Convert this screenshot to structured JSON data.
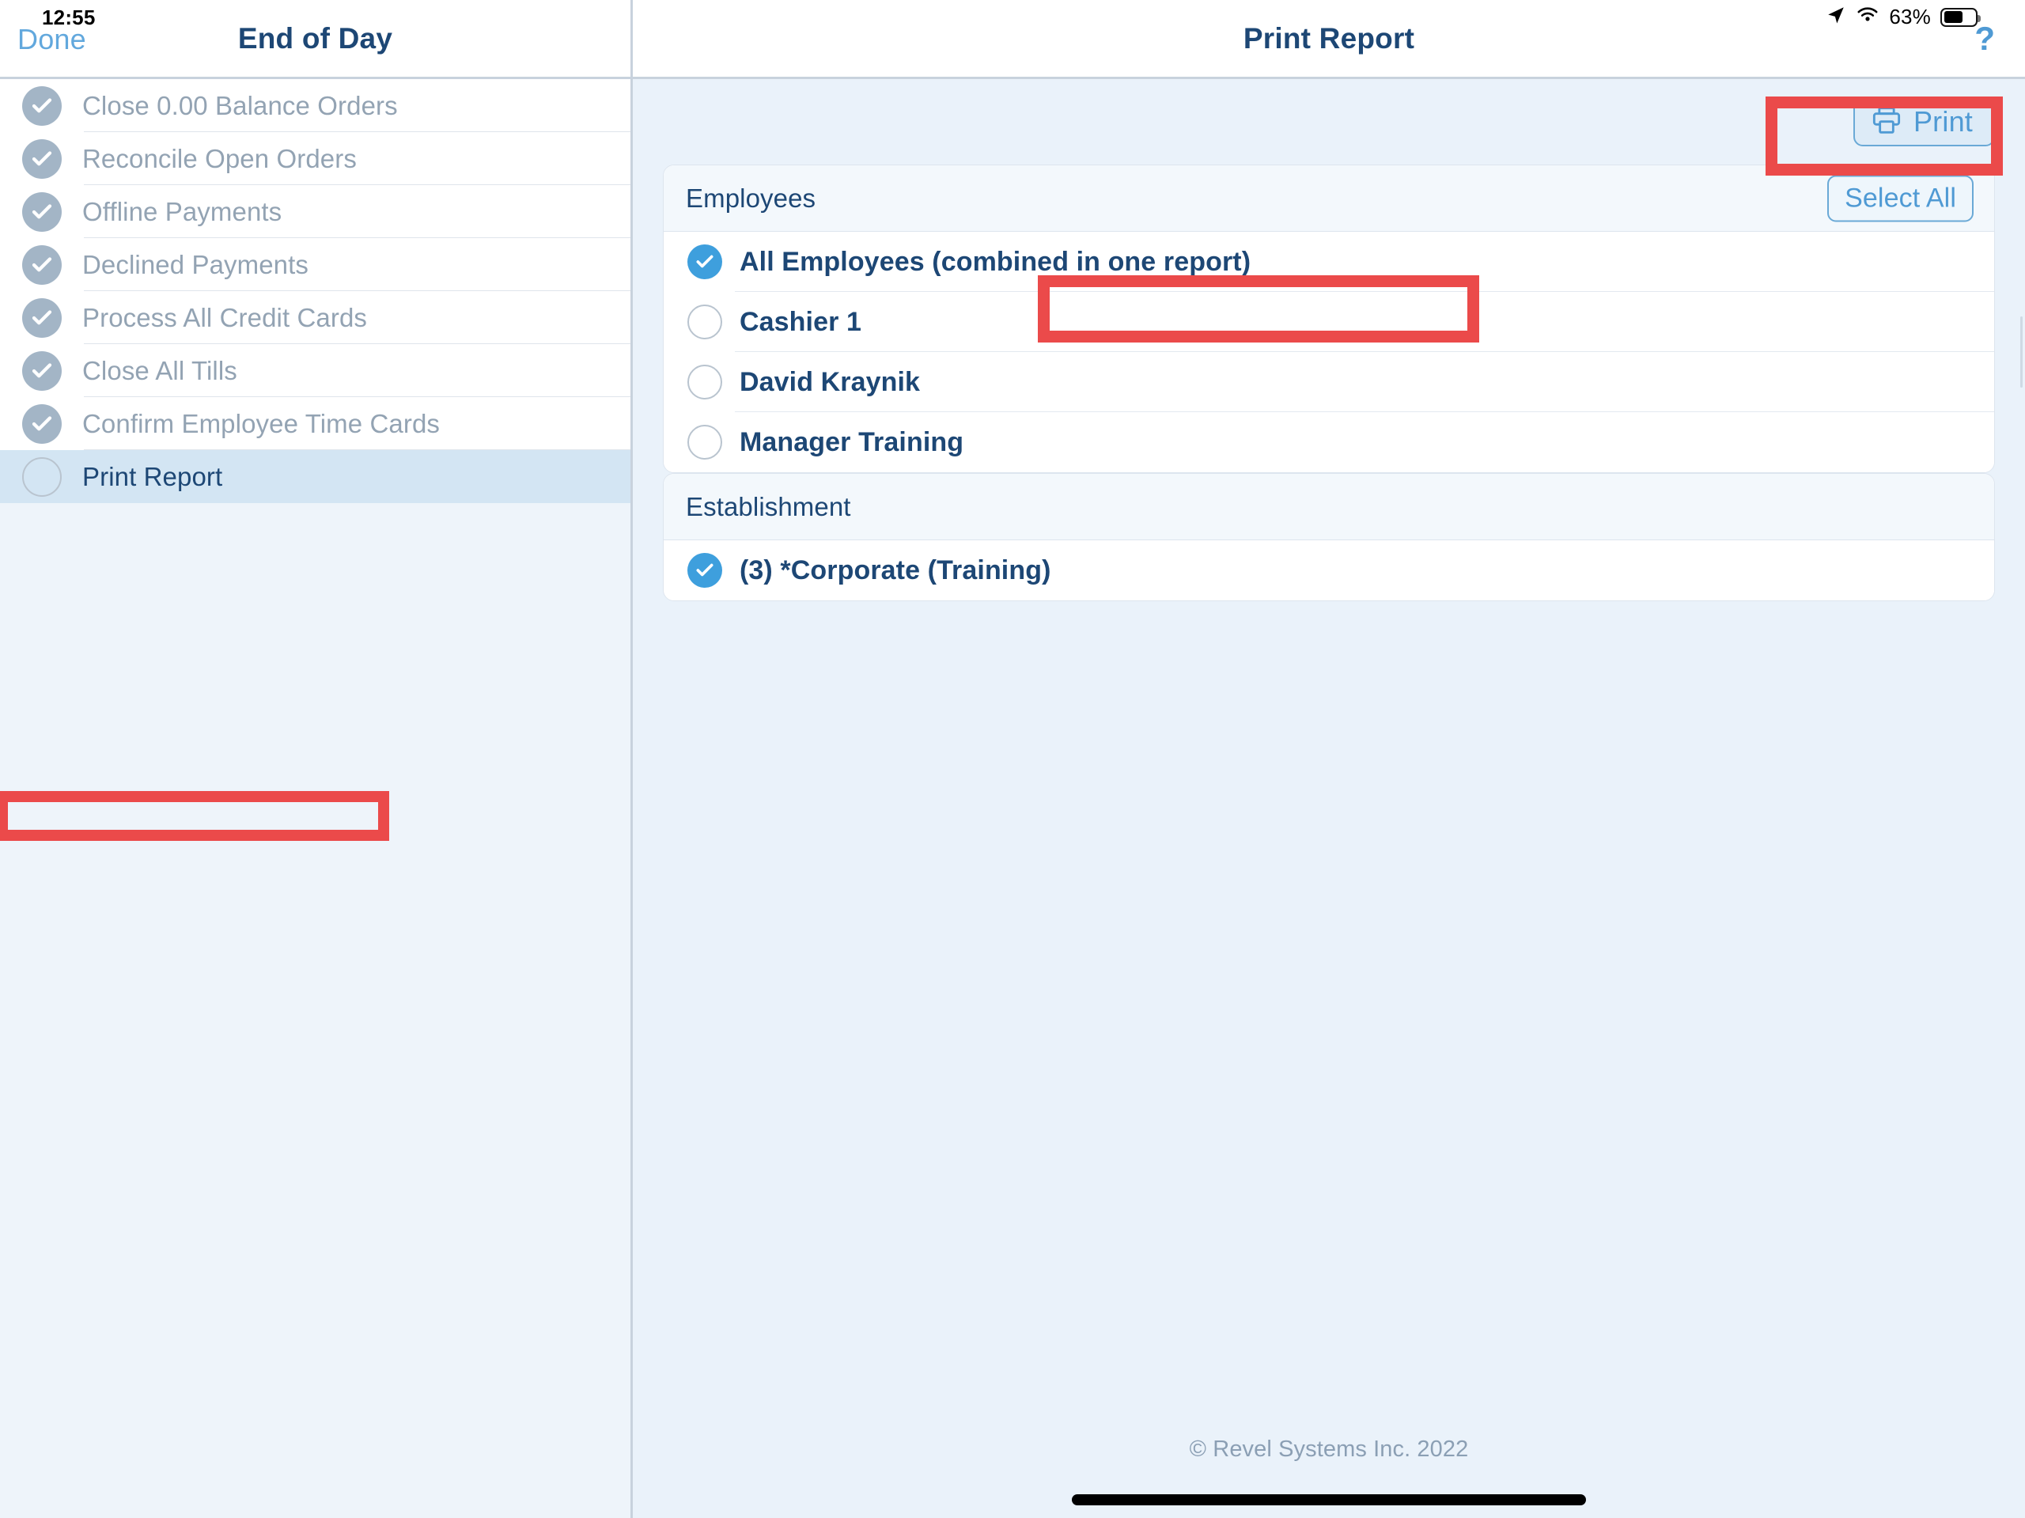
{
  "status_bar": {
    "time": "12:55",
    "battery_percent": "63%",
    "battery_level": 63,
    "location_icon": "location-arrow-icon",
    "wifi_icon": "wifi-icon"
  },
  "sidebar": {
    "done_label": "Done",
    "title": "End of Day",
    "items": [
      {
        "label": "Close 0.00 Balance Orders",
        "state": "checked"
      },
      {
        "label": "Reconcile Open Orders",
        "state": "checked"
      },
      {
        "label": "Offline Payments",
        "state": "checked"
      },
      {
        "label": "Declined Payments",
        "state": "checked"
      },
      {
        "label": "Process All Credit Cards",
        "state": "checked"
      },
      {
        "label": "Close All Tills",
        "state": "checked"
      },
      {
        "label": "Confirm Employee Time Cards",
        "state": "checked"
      },
      {
        "label": "Print Report",
        "state": "unchecked",
        "active": true
      }
    ]
  },
  "main": {
    "title": "Print Report",
    "help_label": "?",
    "print_button": {
      "label": "Print",
      "icon": "printer-icon"
    },
    "employees_card": {
      "header": "Employees",
      "select_all_label": "Select All",
      "options": [
        {
          "label": "All Employees (combined in one report)",
          "selected": true,
          "bold": true
        },
        {
          "label": "Cashier 1",
          "selected": false,
          "bold": true
        },
        {
          "label": "David Kraynik",
          "selected": false,
          "bold": true
        },
        {
          "label": "Manager Training",
          "selected": false,
          "bold": true
        }
      ]
    },
    "establishment_card": {
      "header": "Establishment",
      "options": [
        {
          "label": "(3) *Corporate (Training)",
          "selected": true,
          "bold": true
        }
      ]
    },
    "footer": "© Revel Systems Inc. 2022"
  },
  "colors": {
    "accent_blue": "#4f9ad4",
    "title_navy": "#1d4775",
    "highlight_red": "#eb4a4a",
    "checked_gray": "#a3b5c6",
    "panel_bg": "#eaf2fa",
    "selected_row": "#d3e5f3"
  }
}
